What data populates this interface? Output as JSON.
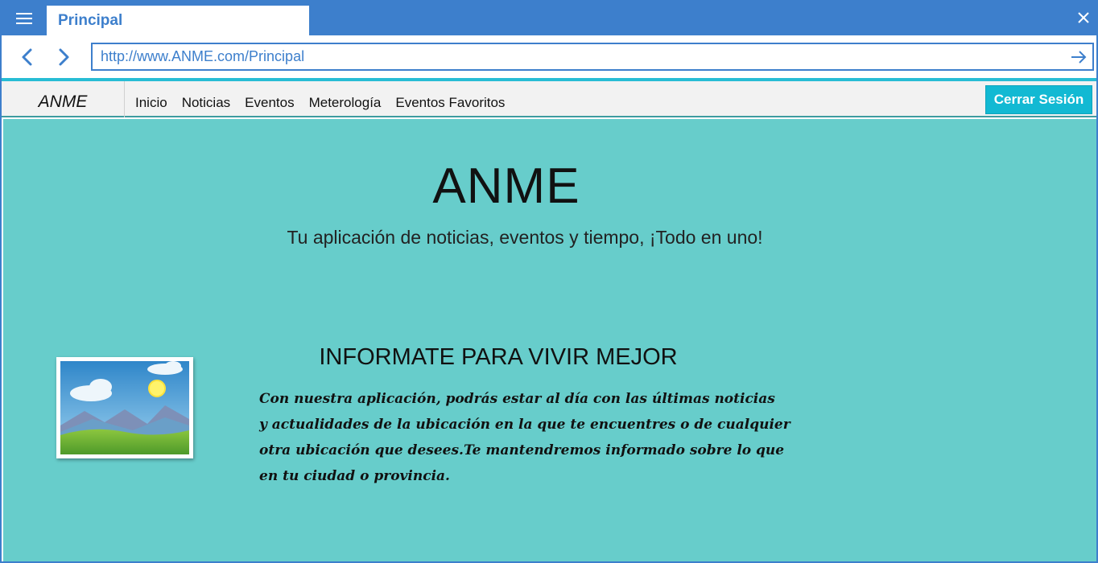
{
  "browser": {
    "tab_title": "Principal",
    "url": "http://www.ANME.com/Principal",
    "accent_color": "#3d7fcc",
    "icons": {
      "menu": "hamburger-icon",
      "close": "close-icon",
      "back": "chevron-left-icon",
      "forward": "chevron-right-icon",
      "go": "arrow-right-icon"
    }
  },
  "header": {
    "brand": "ANME",
    "menu": [
      {
        "label": "Inicio"
      },
      {
        "label": "Noticias"
      },
      {
        "label": "Eventos"
      },
      {
        "label": "Meterología"
      },
      {
        "label": "Eventos Favoritos"
      }
    ],
    "logout_label": "Cerrar Sesión",
    "logout_color": "#12b9d3"
  },
  "main": {
    "background_color": "#67cdcb",
    "title": "ANME",
    "subtitle": "Tu aplicación de noticias, eventos y tiempo, ¡Todo en uno!",
    "section": {
      "title": "INFORMATE PARA VIVIR MEJOR",
      "lines": [
        "Con nuestra aplicación, podrás estar al día con las últimas noticias",
        "y actualidades de la ubicación en la que te encuentres o de cualquier",
        "otra ubicación que desees.Te mantendremos informado sobre lo que",
        "en tu ciudad o provincia."
      ],
      "image_icon": "landscape-image-icon"
    }
  }
}
